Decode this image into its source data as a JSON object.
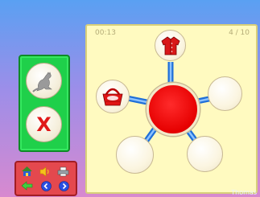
{
  "game": {
    "timer": "00:13",
    "progress": "4  /  10",
    "brand": "Thomas"
  },
  "choices": {
    "top_icon": "kangaroo-icon",
    "bottom_label": "X"
  },
  "board": {
    "hub_color": "#e60000",
    "filled_nodes": [
      "jacket-icon",
      "basket-icon"
    ],
    "empty_nodes": 3
  },
  "toolbar": {
    "icons": [
      "home-icon",
      "speaker-icon",
      "printer-icon",
      "back-arrow-icon",
      "previous-icon",
      "next-icon"
    ]
  }
}
